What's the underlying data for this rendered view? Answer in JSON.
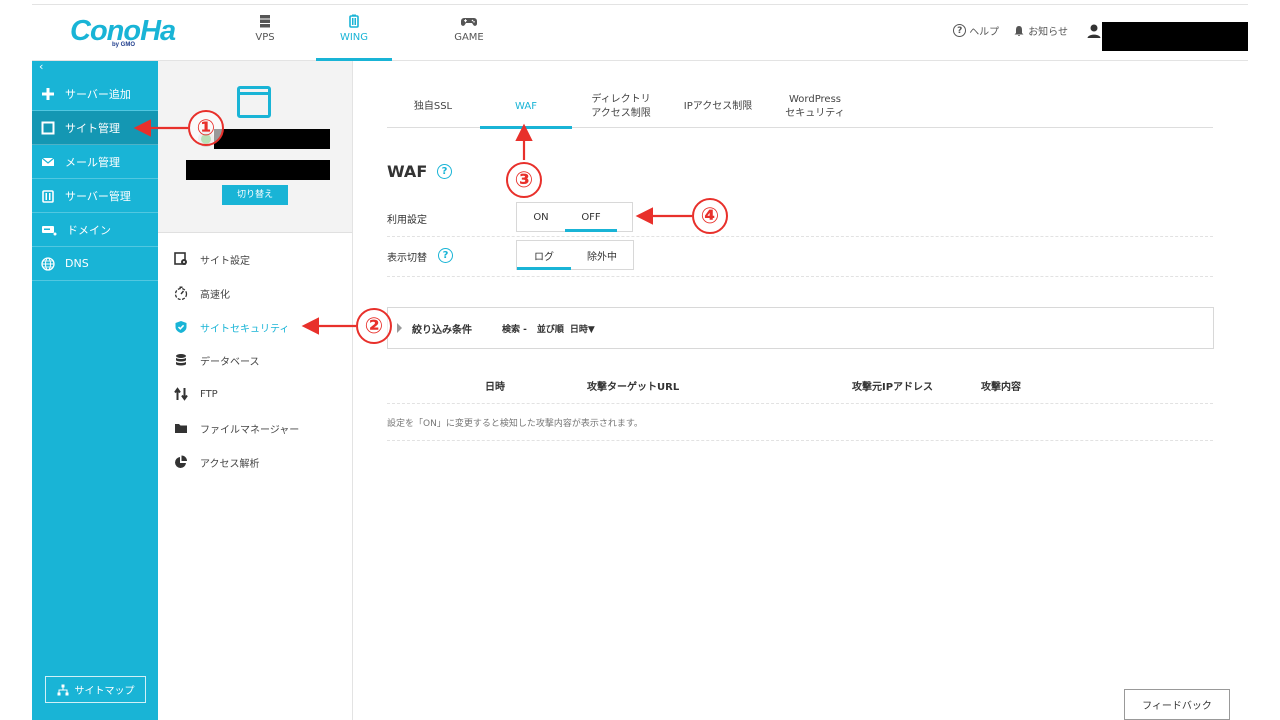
{
  "header": {
    "logo": "ConoHa",
    "logo_sub": "by GMO",
    "tabs": [
      {
        "label": "VPS",
        "icon": "server-icon"
      },
      {
        "label": "WING",
        "icon": "wing-icon"
      },
      {
        "label": "GAME",
        "icon": "gamepad-icon"
      }
    ],
    "help": "ヘルプ",
    "notice": "お知らせ"
  },
  "sidebar": {
    "collapse": "‹",
    "items": [
      {
        "label": "サーバー追加",
        "icon": "plus-icon"
      },
      {
        "label": "サイト管理",
        "icon": "window-icon"
      },
      {
        "label": "メール管理",
        "icon": "mail-icon"
      },
      {
        "label": "サーバー管理",
        "icon": "server-manage-icon"
      },
      {
        "label": "ドメイン",
        "icon": "domain-icon"
      },
      {
        "label": "DNS",
        "icon": "globe-icon"
      }
    ],
    "sitemap": "サイトマップ"
  },
  "site_panel": {
    "switch_label": "切り替え",
    "menu": [
      {
        "label": "サイト設定",
        "icon": "site-settings-icon"
      },
      {
        "label": "高速化",
        "icon": "speed-icon"
      },
      {
        "label": "サイトセキュリティ",
        "icon": "shield-icon"
      },
      {
        "label": "データベース",
        "icon": "database-icon"
      },
      {
        "label": "FTP",
        "icon": "ftp-icon"
      },
      {
        "label": "ファイルマネージャー",
        "icon": "folder-icon"
      },
      {
        "label": "アクセス解析",
        "icon": "pie-chart-icon"
      }
    ]
  },
  "main": {
    "tabs": [
      {
        "label": "独自SSL"
      },
      {
        "label": "WAF"
      },
      {
        "label": "ディレクトリ\nアクセス制限"
      },
      {
        "label": "IPアクセス制限"
      },
      {
        "label": "WordPress\nセキュリティ"
      }
    ],
    "title": "WAF",
    "usage_label": "利用設定",
    "usage_on": "ON",
    "usage_off": "OFF",
    "display_label": "表示切替",
    "display_log": "ログ",
    "display_excluded": "除外中",
    "filter_label": "絞り込み条件",
    "filter_search": "検索 -",
    "filter_sort": "並び順",
    "filter_sort_value": "日時▼",
    "columns": [
      "日時",
      "攻撃ターゲットURL",
      "攻撃元IPアドレス",
      "攻撃内容"
    ],
    "empty_message": "設定を「ON」に変更すると検知した攻撃内容が表示されます。",
    "feedback": "フィードバック"
  },
  "annotations": [
    "①",
    "②",
    "③",
    "④"
  ],
  "colors": {
    "accent": "#19b4d6",
    "annotation": "#e8302b",
    "sidebar_active": "#1497b3"
  }
}
